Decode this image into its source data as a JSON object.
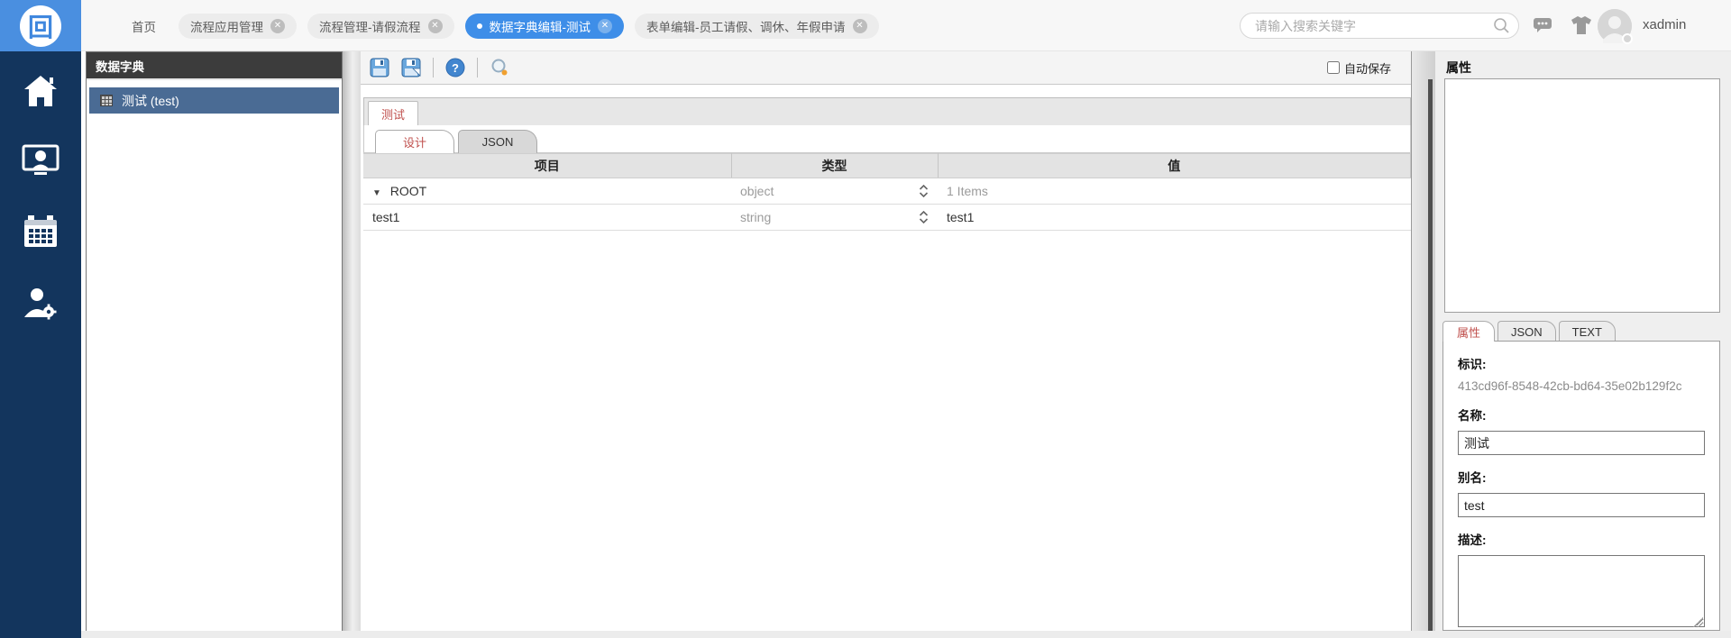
{
  "colors": {
    "accent_blue": "#3e8ee8",
    "sidebar_navy": "#13355d",
    "tree_selection": "#4a6b94",
    "active_tab_red": "#c0504d",
    "muted_text": "#9b9b9b"
  },
  "topbar": {
    "logo_glyph": "回",
    "tabs": [
      {
        "label": "首页",
        "active": false,
        "closable": false
      },
      {
        "label": "流程应用管理",
        "active": false,
        "closable": true
      },
      {
        "label": "流程管理-请假流程",
        "active": false,
        "closable": true
      },
      {
        "label": "数据字典编辑-测试",
        "active": true,
        "closable": true
      },
      {
        "label": "表单编辑-员工请假、调休、年假申请",
        "active": false,
        "closable": true
      }
    ],
    "close_glyph": "✕",
    "search": {
      "placeholder": "请输入搜索关键字",
      "value": "",
      "icon": "search-icon"
    },
    "right_icons": [
      "message-icon",
      "theme-tshirt-icon",
      "avatar"
    ],
    "username": "xadmin"
  },
  "sidebar": {
    "items": [
      {
        "icon": "home-icon"
      },
      {
        "icon": "user-monitor-icon"
      },
      {
        "icon": "calendar-icon"
      },
      {
        "icon": "user-settings-icon"
      }
    ]
  },
  "tree_panel": {
    "title": "数据字典",
    "items": [
      {
        "label": "测试 (test)",
        "selected": true,
        "icon": "dictionary-grid-icon"
      }
    ]
  },
  "main": {
    "toolbar": {
      "icons": [
        "save-icon",
        "save-as-icon",
        "help-icon",
        "preview-icon"
      ],
      "autosave_label": "自动保存",
      "autosave_checked": false
    },
    "doc_tabs": [
      {
        "label": "测试",
        "active": true
      }
    ],
    "view_tabs": [
      {
        "label": "设计",
        "active": true
      },
      {
        "label": "JSON",
        "active": false
      }
    ],
    "table": {
      "columns": [
        "项目",
        "类型",
        "值"
      ],
      "rows": [
        {
          "item": "ROOT",
          "caret": "▼",
          "indent": 0,
          "type": "object",
          "value": "1 Items",
          "value_muted": true
        },
        {
          "item": "test1",
          "caret": "",
          "indent": 1,
          "type": "string",
          "value": "test1",
          "value_muted": false
        }
      ]
    }
  },
  "properties": {
    "panel_title": "属性",
    "tabs": [
      {
        "label": "属性",
        "active": true
      },
      {
        "label": "JSON",
        "active": false
      },
      {
        "label": "TEXT",
        "active": false
      }
    ],
    "fields": {
      "id": {
        "label": "标识:",
        "value": "413cd96f-8548-42cb-bd64-35e02b129f2c"
      },
      "name": {
        "label": "名称:",
        "value": "测试"
      },
      "alias": {
        "label": "别名:",
        "value": "test"
      },
      "desc": {
        "label": "描述:",
        "value": ""
      }
    }
  }
}
